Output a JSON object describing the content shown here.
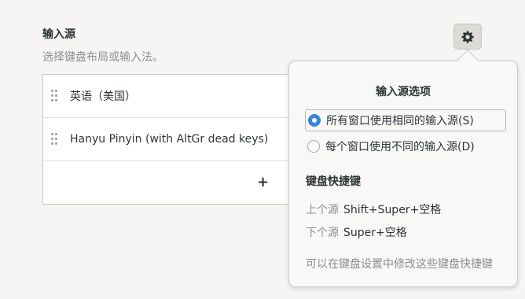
{
  "input_sources": {
    "title": "输入源",
    "subtitle": "选择键盘布局或输入法。",
    "items": [
      {
        "label": "英语（美国）"
      },
      {
        "label": "Hanyu Pinyin (with AltGr dead keys)"
      }
    ],
    "add_label": "+"
  },
  "popover": {
    "title": "输入源选项",
    "options": [
      {
        "label": "所有窗口使用相同的输入源(S)",
        "selected": true
      },
      {
        "label": "每个窗口使用不同的输入源(D)",
        "selected": false
      }
    ],
    "shortcuts_title": "键盘快捷键",
    "shortcuts": [
      {
        "name": "上个源",
        "keys": "Shift+Super+空格"
      },
      {
        "name": "下个源",
        "keys": "Super+空格"
      }
    ],
    "note": "可以在键盘设置中修改这些键盘快捷键"
  },
  "icons": {
    "options_button": "gear-icon",
    "drag_handle": "drag-handle-icon"
  },
  "colors": {
    "accent": "#3584e4",
    "background": "#f6f5f4"
  }
}
